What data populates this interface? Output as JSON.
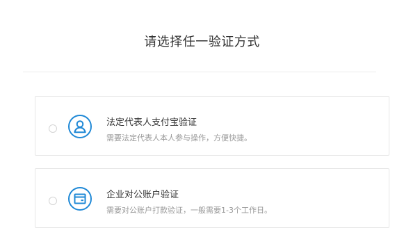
{
  "title": "请选择任一验证方式",
  "options": [
    {
      "title": "法定代表人支付宝验证",
      "description": "需要法定代表人本人参与操作，方便快捷。",
      "icon": "person-icon",
      "selected": false
    },
    {
      "title": "企业对公账户验证",
      "description": "需要对公账户打款验证，一般需要1-3个工作日。",
      "icon": "bank-card-icon",
      "selected": false
    }
  ],
  "colors": {
    "accent": "#1e88d6",
    "title_text": "#333333",
    "secondary_text": "#999999",
    "border": "#e6e6e6"
  }
}
